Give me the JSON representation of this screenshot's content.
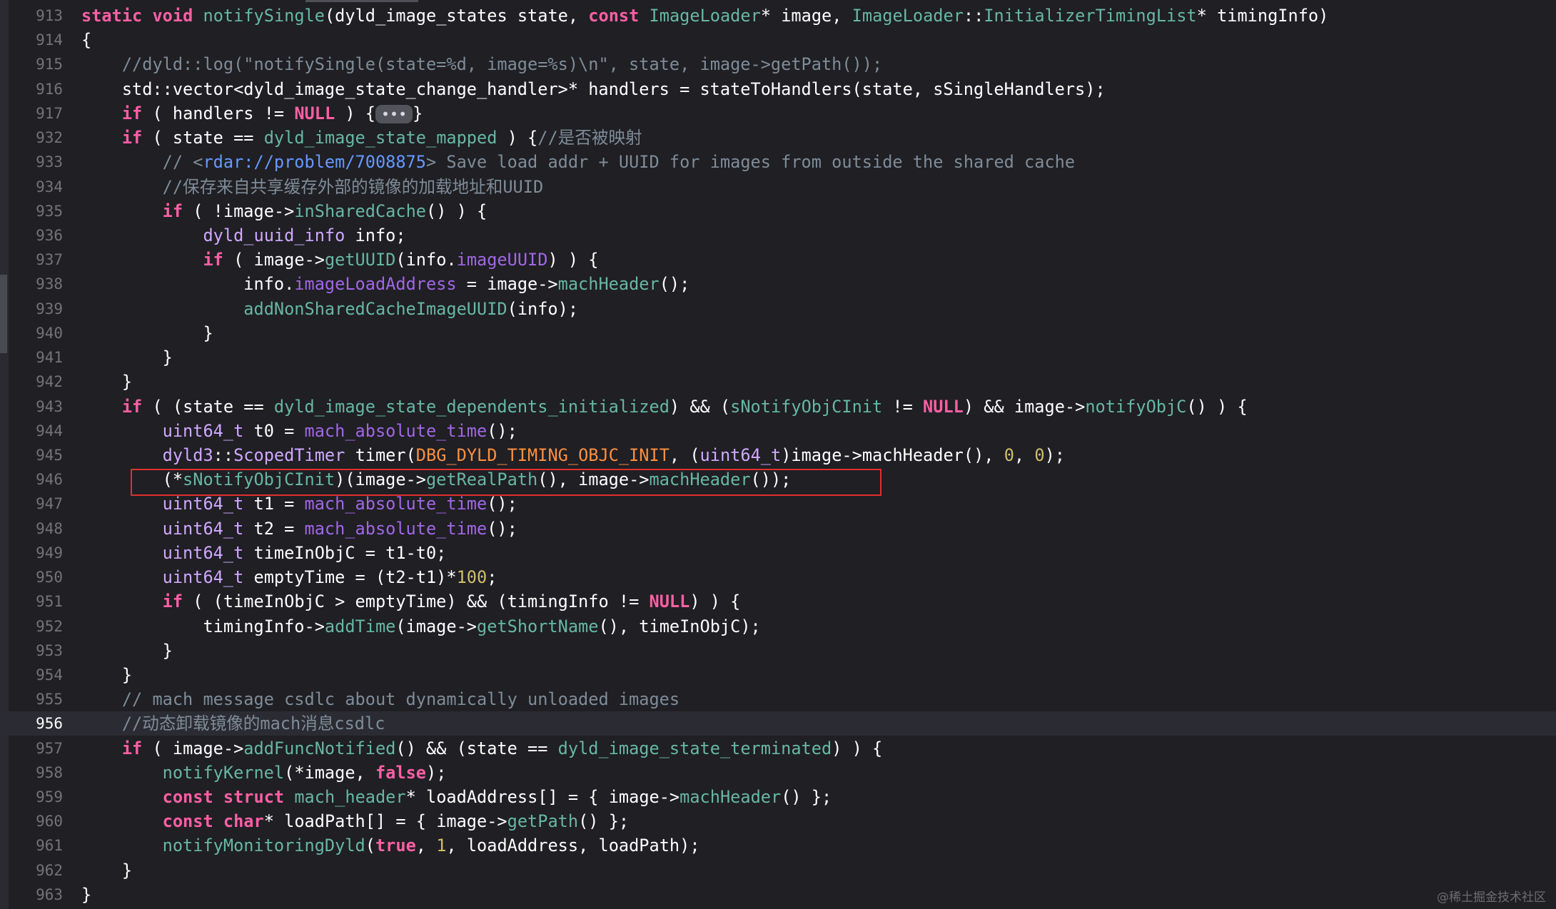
{
  "editor": {
    "current_line": "956",
    "lines": [
      {
        "n": "913",
        "tokens": [
          [
            "kw",
            "static"
          ],
          [
            "pl",
            " "
          ],
          [
            "kw",
            "void"
          ],
          [
            "pl",
            " "
          ],
          [
            "func",
            "notifySingle"
          ],
          [
            "pl",
            "(dyld_image_states state, "
          ],
          [
            "kw",
            "const"
          ],
          [
            "pl",
            " "
          ],
          [
            "func",
            "ImageLoader"
          ],
          [
            "pl",
            "* image, "
          ],
          [
            "func",
            "ImageLoader"
          ],
          [
            "pl",
            "::"
          ],
          [
            "func",
            "InitializerTimingList"
          ],
          [
            "pl",
            "* timingInfo)"
          ]
        ]
      },
      {
        "n": "914",
        "tokens": [
          [
            "pl",
            "{"
          ]
        ]
      },
      {
        "n": "915",
        "tokens": [
          [
            "pl",
            "    "
          ],
          [
            "cmt",
            "//dyld::log(\"notifySingle(state=%d, image=%s)\\n\", state, image->getPath());"
          ]
        ]
      },
      {
        "n": "916",
        "tokens": [
          [
            "pl",
            "    std::vector<dyld_image_state_change_handler>* handlers = stateToHandlers(state, sSingleHandlers);"
          ]
        ]
      },
      {
        "n": "917",
        "tokens": [
          [
            "pl",
            "    "
          ],
          [
            "kw",
            "if"
          ],
          [
            "pl",
            " ( handlers != "
          ],
          [
            "kw",
            "NULL"
          ],
          [
            "pl",
            " ) {"
          ],
          [
            "fold",
            "•••"
          ],
          [
            "pl",
            "}"
          ]
        ]
      },
      {
        "n": "932",
        "tokens": [
          [
            "pl",
            "    "
          ],
          [
            "kw",
            "if"
          ],
          [
            "pl",
            " ( state == "
          ],
          [
            "func",
            "dyld_image_state_mapped"
          ],
          [
            "pl",
            " ) {"
          ],
          [
            "cmt",
            "//是否被映射"
          ]
        ]
      },
      {
        "n": "933",
        "tokens": [
          [
            "pl",
            "        "
          ],
          [
            "cmt",
            "// <"
          ],
          [
            "url",
            "rdar://problem/7008875"
          ],
          [
            "cmt",
            "> Save load addr + UUID for images from outside the shared cache"
          ]
        ]
      },
      {
        "n": "934",
        "tokens": [
          [
            "pl",
            "        "
          ],
          [
            "cmt",
            "//保存来自共享缓存外部的镜像的加载地址和UUID"
          ]
        ]
      },
      {
        "n": "935",
        "tokens": [
          [
            "pl",
            "        "
          ],
          [
            "kw",
            "if"
          ],
          [
            "pl",
            " ( !image->"
          ],
          [
            "func",
            "inSharedCache"
          ],
          [
            "pl",
            "() ) {"
          ]
        ]
      },
      {
        "n": "936",
        "tokens": [
          [
            "pl",
            "            "
          ],
          [
            "type",
            "dyld_uuid_info"
          ],
          [
            "pl",
            " info;"
          ]
        ]
      },
      {
        "n": "937",
        "tokens": [
          [
            "pl",
            "            "
          ],
          [
            "kw",
            "if"
          ],
          [
            "pl",
            " ( image->"
          ],
          [
            "func",
            "getUUID"
          ],
          [
            "pl",
            "(info."
          ],
          [
            "fn2",
            "imageUUID"
          ],
          [
            "pl",
            ") ) {"
          ]
        ]
      },
      {
        "n": "938",
        "tokens": [
          [
            "pl",
            "                info."
          ],
          [
            "fn2",
            "imageLoadAddress"
          ],
          [
            "pl",
            " = image->"
          ],
          [
            "func",
            "machHeader"
          ],
          [
            "pl",
            "();"
          ]
        ]
      },
      {
        "n": "939",
        "tokens": [
          [
            "pl",
            "                "
          ],
          [
            "func",
            "addNonSharedCacheImageUUID"
          ],
          [
            "pl",
            "(info);"
          ]
        ]
      },
      {
        "n": "940",
        "tokens": [
          [
            "pl",
            "            }"
          ]
        ]
      },
      {
        "n": "941",
        "tokens": [
          [
            "pl",
            "        }"
          ]
        ]
      },
      {
        "n": "942",
        "tokens": [
          [
            "pl",
            "    }"
          ]
        ]
      },
      {
        "n": "943",
        "tokens": [
          [
            "pl",
            "    "
          ],
          [
            "kw",
            "if"
          ],
          [
            "pl",
            " ( (state == "
          ],
          [
            "func",
            "dyld_image_state_dependents_initialized"
          ],
          [
            "pl",
            ") && ("
          ],
          [
            "func",
            "sNotifyObjCInit"
          ],
          [
            "pl",
            " != "
          ],
          [
            "kw",
            "NULL"
          ],
          [
            "pl",
            ") && image->"
          ],
          [
            "func",
            "notifyObjC"
          ],
          [
            "pl",
            "() ) {"
          ]
        ]
      },
      {
        "n": "944",
        "tokens": [
          [
            "pl",
            "        "
          ],
          [
            "type",
            "uint64_t"
          ],
          [
            "pl",
            " t0 = "
          ],
          [
            "fn2",
            "mach_absolute_time"
          ],
          [
            "pl",
            "();"
          ]
        ]
      },
      {
        "n": "945",
        "tokens": [
          [
            "pl",
            "        "
          ],
          [
            "type",
            "dyld3"
          ],
          [
            "pl",
            "::"
          ],
          [
            "type",
            "ScopedTimer"
          ],
          [
            "pl",
            " timer("
          ],
          [
            "mac",
            "DBG_DYLD_TIMING_OBJC_INIT"
          ],
          [
            "pl",
            ", ("
          ],
          [
            "type",
            "uint64_t"
          ],
          [
            "pl",
            ")image->machHeader(), "
          ],
          [
            "num",
            "0"
          ],
          [
            "pl",
            ", "
          ],
          [
            "num",
            "0"
          ],
          [
            "pl",
            ");"
          ]
        ]
      },
      {
        "n": "946",
        "tokens": [
          [
            "pl",
            "        (*"
          ],
          [
            "func",
            "sNotifyObjCInit"
          ],
          [
            "pl",
            ")(image->"
          ],
          [
            "func",
            "getRealPath"
          ],
          [
            "pl",
            "(), image->"
          ],
          [
            "func",
            "machHeader"
          ],
          [
            "pl",
            "());"
          ]
        ]
      },
      {
        "n": "947",
        "tokens": [
          [
            "pl",
            "        "
          ],
          [
            "type",
            "uint64_t"
          ],
          [
            "pl",
            " t1 = "
          ],
          [
            "fn2",
            "mach_absolute_time"
          ],
          [
            "pl",
            "();"
          ]
        ]
      },
      {
        "n": "948",
        "tokens": [
          [
            "pl",
            "        "
          ],
          [
            "type",
            "uint64_t"
          ],
          [
            "pl",
            " t2 = "
          ],
          [
            "fn2",
            "mach_absolute_time"
          ],
          [
            "pl",
            "();"
          ]
        ]
      },
      {
        "n": "949",
        "tokens": [
          [
            "pl",
            "        "
          ],
          [
            "type",
            "uint64_t"
          ],
          [
            "pl",
            " timeInObjC = t1-t0;"
          ]
        ]
      },
      {
        "n": "950",
        "tokens": [
          [
            "pl",
            "        "
          ],
          [
            "type",
            "uint64_t"
          ],
          [
            "pl",
            " emptyTime = (t2-t1)*"
          ],
          [
            "num",
            "100"
          ],
          [
            "pl",
            ";"
          ]
        ]
      },
      {
        "n": "951",
        "tokens": [
          [
            "pl",
            "        "
          ],
          [
            "kw",
            "if"
          ],
          [
            "pl",
            " ( (timeInObjC > emptyTime) && (timingInfo != "
          ],
          [
            "kw",
            "NULL"
          ],
          [
            "pl",
            ") ) {"
          ]
        ]
      },
      {
        "n": "952",
        "tokens": [
          [
            "pl",
            "            timingInfo->"
          ],
          [
            "func",
            "addTime"
          ],
          [
            "pl",
            "(image->"
          ],
          [
            "func",
            "getShortName"
          ],
          [
            "pl",
            "(), timeInObjC);"
          ]
        ]
      },
      {
        "n": "953",
        "tokens": [
          [
            "pl",
            "        }"
          ]
        ]
      },
      {
        "n": "954",
        "tokens": [
          [
            "pl",
            "    }"
          ]
        ]
      },
      {
        "n": "955",
        "tokens": [
          [
            "pl",
            "    "
          ],
          [
            "cmt",
            "// mach message csdlc about dynamically unloaded images"
          ]
        ]
      },
      {
        "n": "956",
        "tokens": [
          [
            "pl",
            "    "
          ],
          [
            "cmt",
            "//动态卸载镜像的mach消息csdlc"
          ]
        ]
      },
      {
        "n": "957",
        "tokens": [
          [
            "pl",
            "    "
          ],
          [
            "kw",
            "if"
          ],
          [
            "pl",
            " ( image->"
          ],
          [
            "func",
            "addFuncNotified"
          ],
          [
            "pl",
            "() && (state == "
          ],
          [
            "func",
            "dyld_image_state_terminated"
          ],
          [
            "pl",
            ") ) {"
          ]
        ]
      },
      {
        "n": "958",
        "tokens": [
          [
            "pl",
            "        "
          ],
          [
            "func",
            "notifyKernel"
          ],
          [
            "pl",
            "(*image, "
          ],
          [
            "kw",
            "false"
          ],
          [
            "pl",
            ");"
          ]
        ]
      },
      {
        "n": "959",
        "tokens": [
          [
            "pl",
            "        "
          ],
          [
            "kw",
            "const"
          ],
          [
            "pl",
            " "
          ],
          [
            "kw",
            "struct"
          ],
          [
            "pl",
            " "
          ],
          [
            "func",
            "mach_header"
          ],
          [
            "pl",
            "* loadAddress[] = { image->"
          ],
          [
            "func",
            "machHeader"
          ],
          [
            "pl",
            "() };"
          ]
        ]
      },
      {
        "n": "960",
        "tokens": [
          [
            "pl",
            "        "
          ],
          [
            "kw",
            "const"
          ],
          [
            "pl",
            " "
          ],
          [
            "kw",
            "char"
          ],
          [
            "pl",
            "* loadPath[] = { image->"
          ],
          [
            "func",
            "getPath"
          ],
          [
            "pl",
            "() };"
          ]
        ]
      },
      {
        "n": "961",
        "tokens": [
          [
            "pl",
            "        "
          ],
          [
            "func",
            "notifyMonitoringDyld"
          ],
          [
            "pl",
            "("
          ],
          [
            "kw",
            "true"
          ],
          [
            "pl",
            ", "
          ],
          [
            "num",
            "1"
          ],
          [
            "pl",
            ", loadAddress, loadPath);"
          ]
        ]
      },
      {
        "n": "962",
        "tokens": [
          [
            "pl",
            "    }"
          ]
        ]
      },
      {
        "n": "963",
        "tokens": [
          [
            "pl",
            "}"
          ]
        ]
      }
    ]
  },
  "watermark": "@稀土掘金技术社区"
}
